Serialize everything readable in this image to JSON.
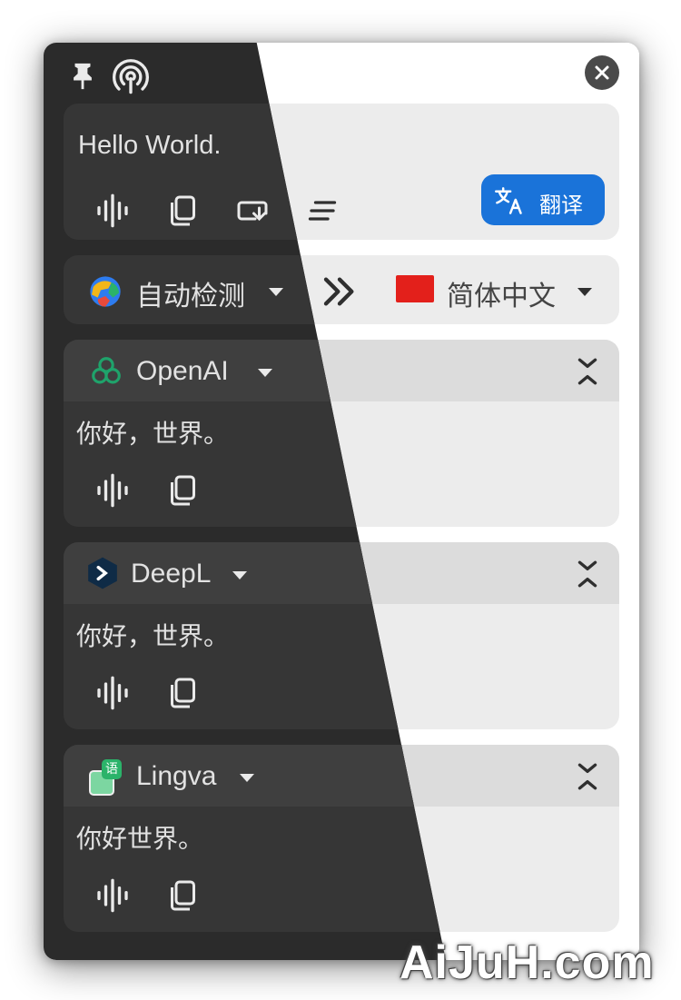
{
  "source": {
    "text": "Hello World.",
    "translate_button": "翻译"
  },
  "languages": {
    "from": "自动检测",
    "to": "简体中文"
  },
  "results": [
    {
      "service": "OpenAI",
      "text": "你好，世界。"
    },
    {
      "service": "DeepL",
      "text": "你好，世界。"
    },
    {
      "service": "Lingva",
      "text": "你好世界。"
    }
  ],
  "lingva_badge": "语",
  "watermark": "AiJuH.com",
  "colors": {
    "accent": "#1a73d9",
    "openai_green": "#1fa36b",
    "deepl_navy": "#0f2b46",
    "lingva_green": "#2bb36a",
    "flag_red": "#e3201b"
  },
  "icons": [
    "pin-icon",
    "broadcast-icon",
    "close-icon",
    "speaker-icon",
    "copy-icon",
    "insert-icon",
    "format-icon",
    "translate-icon",
    "dropdown-icon",
    "arrow-right-icon",
    "collapse-icon"
  ]
}
